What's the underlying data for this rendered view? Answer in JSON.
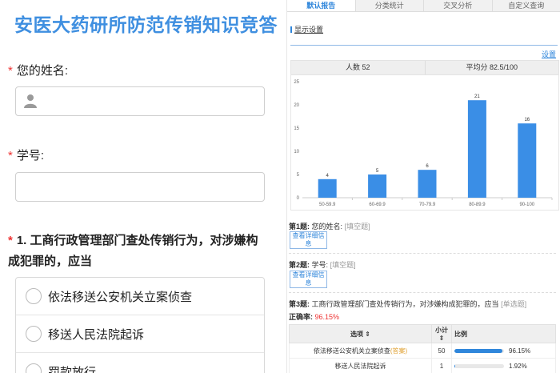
{
  "form": {
    "title": "安医大药研所防范传销知识竞答",
    "q_name": "您的姓名:",
    "q_id": "学号:",
    "q1_text": "1. 工商行政管理部门查处传销行为，对涉嫌构成犯罪的，应当",
    "options": [
      "依法移送公安机关立案侦查",
      "移送人民法院起诉",
      "罚款放行"
    ]
  },
  "report": {
    "tabs": [
      "默认报告",
      "分类统计",
      "交叉分析",
      "自定义查询"
    ],
    "show_settings": "显示设置",
    "settings_link": "设置",
    "people_label": "人数 52",
    "avg_label": "平均分 82.5/100",
    "q1_num": "第1题:",
    "q1_title": "您的姓名:",
    "q1_type": "[填空题]",
    "q2_num": "第2题:",
    "q2_title": "学号:",
    "q2_type": "[填空题]",
    "q3_num": "第3题:",
    "q3_title": "工商行政管理部门查处传销行为，对涉嫌构成犯罪的，应当",
    "q3_type": "[单选题]",
    "detail_btn": "查看详细信息",
    "accuracy_label": "正确率:",
    "accuracy_value": "96.15%",
    "table": {
      "headers": [
        "选项",
        "小计",
        "比例"
      ],
      "rows": [
        {
          "option": "依法移送公安机关立案侦查",
          "tag": "(答案)",
          "count": "50",
          "pct": "96.15%",
          "fraction": 0.9615
        },
        {
          "option": "移送人民法院起诉",
          "tag": "",
          "count": "1",
          "pct": "1.92%",
          "fraction": 0.0192
        }
      ]
    }
  },
  "colors": {
    "title_blue": "#3f8fe0",
    "bar_blue": "#3a8ee6",
    "required_red": "#e33333",
    "answer_orange": "#e0a030"
  },
  "chart_data": {
    "type": "bar",
    "categories": [
      "50-59.9",
      "60-69.9",
      "70-79.9",
      "80-89.9",
      "90-100"
    ],
    "values": [
      4,
      5,
      6,
      21,
      16
    ],
    "ylim": [
      0,
      25
    ],
    "yticks": [
      0,
      5,
      10,
      15,
      20,
      25
    ],
    "grid": false
  }
}
